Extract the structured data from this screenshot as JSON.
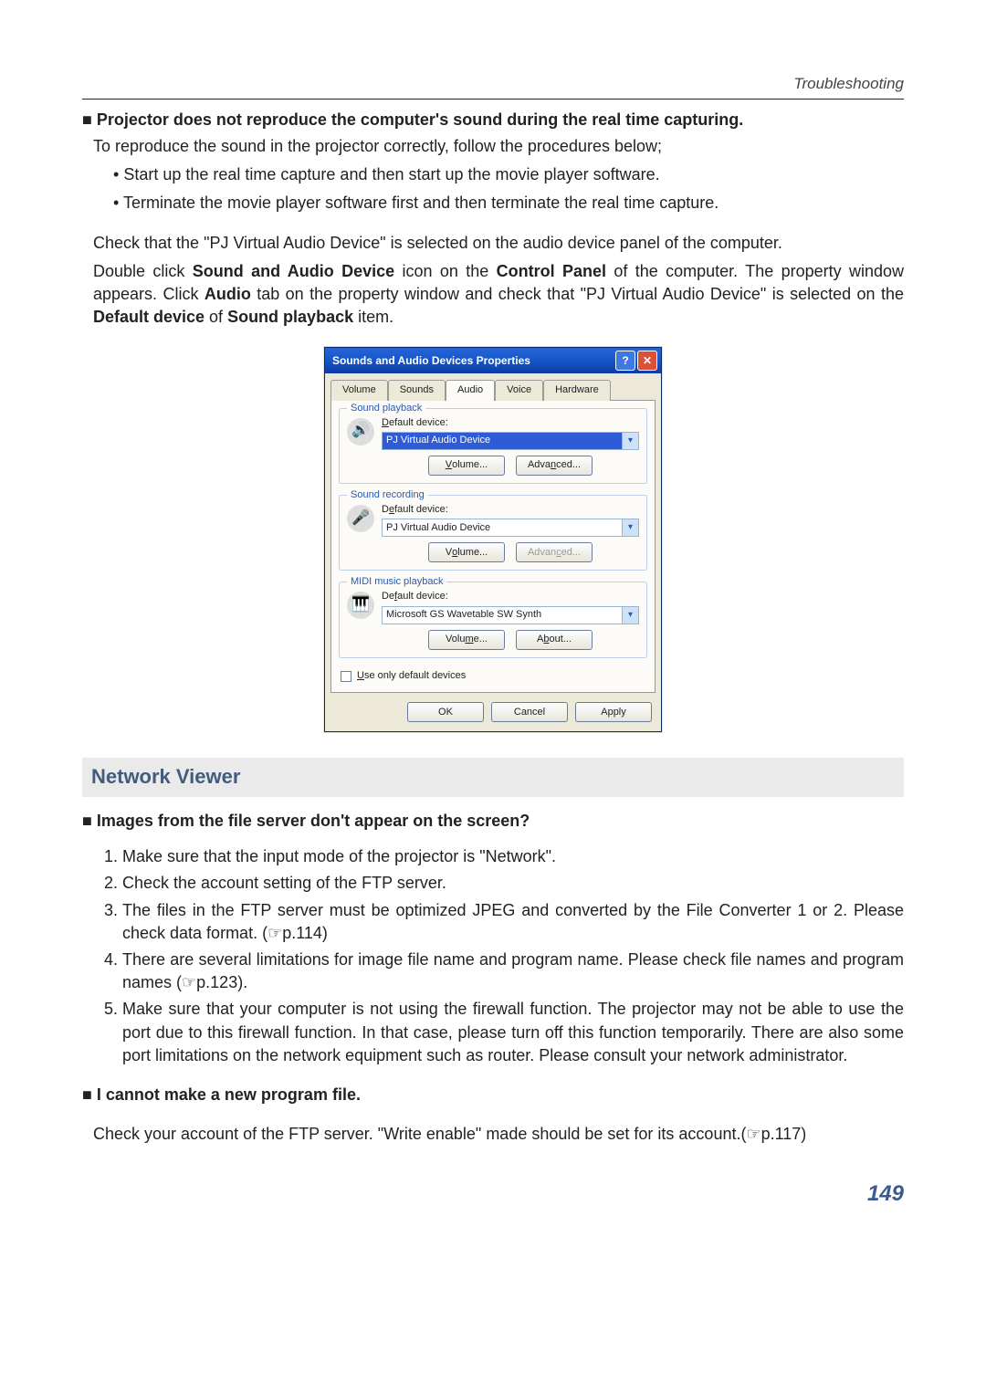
{
  "header": {
    "section": "Troubleshooting"
  },
  "issue1": {
    "title": "Projector does not reproduce the computer's sound during the real time capturing.",
    "intro": "To reproduce the sound in the projector correctly, follow the procedures below;",
    "b1": "Start up the real time capture and then start up the movie player software.",
    "b2": "Terminate the movie player software first and then terminate the real time capture.",
    "p1a": "Check that the \"PJ Virtual Audio Device\" is selected on the audio device panel of the computer.",
    "p1b_1": "Double click ",
    "p1b_bold1": "Sound and Audio Device",
    "p1b_2": " icon on the ",
    "p1b_bold2": "Control Panel",
    "p1b_3": " of the computer. The property window appears. Click ",
    "p1b_bold3": "Audio",
    "p1b_4": " tab on the property window and check that \"PJ Virtual Audio Device\" is selected on the ",
    "p1b_bold4": "Default device",
    "p1b_5": " of ",
    "p1b_bold5": "Sound playback",
    "p1b_6": " item."
  },
  "dialog": {
    "title": "Sounds and Audio Devices Properties",
    "help": "?",
    "close": "✕",
    "tabs": {
      "volume": "Volume",
      "sounds": "Sounds",
      "audio": "Audio",
      "voice": "Voice",
      "hardware": "Hardware"
    },
    "grp_playback": "Sound playback",
    "grp_recording": "Sound recording",
    "grp_midi": "MIDI music playback",
    "default_label": "Default device:",
    "dev_pj": "PJ Virtual Audio Device",
    "dev_midi": "Microsoft GS Wavetable SW Synth",
    "btn_volume": "Volume...",
    "btn_advanced": "Advanced...",
    "btn_about": "About...",
    "chk": "Use only default devices",
    "ok": "OK",
    "cancel": "Cancel",
    "apply": "Apply"
  },
  "viewer": {
    "heading": "Network Viewer",
    "q1": "Images from the file server don't appear on the screen?",
    "l1": "Make sure that the input mode of the projector is \"Network\".",
    "l2": "Check the account setting of the FTP server.",
    "l3": "The files in the FTP server must be optimized JPEG and converted  by the File Converter 1 or 2. Please check data format. (☞p.114)",
    "l4": "There are several limitations for image file name and program name. Please check file names and program names (☞p.123).",
    "l5": "Make sure that your computer is not using the firewall function. The projector may not be able to use the port due to this firewall function. In that case, please turn off this function temporarily. There are also some port limitations on the network equipment such as router. Please consult your network administrator.",
    "q2": "I cannot make a new program file.",
    "p2": "Check your account of the FTP server. \"Write enable\"  made should be set for its account.(☞p.117)"
  },
  "page": "149"
}
